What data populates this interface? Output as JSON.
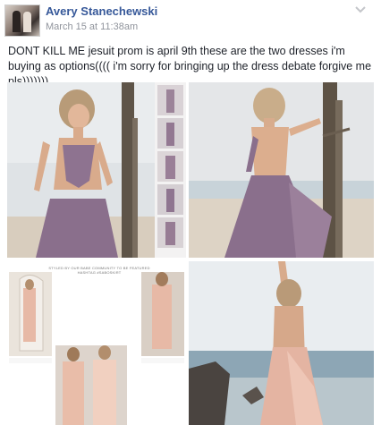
{
  "post": {
    "author": "Avery Stanechewski",
    "timestamp": "March 15 at 11:38am",
    "text": "DONT KILL ME jesuit prom is april 9th these are the two dresses i'm buying as options(((( i'm sorry for bringing up the dress debate forgive me pls)))))))"
  },
  "photos": [
    {
      "subject": "lavender halter cut-out maxi dress",
      "dress_color": "#8e7390"
    },
    {
      "subject": "lavender open-back maxi dress on beach",
      "dress_color": "#8a6f8c"
    },
    {
      "subject": "blush strapless dress collage",
      "dress_color": "#e7b9a6"
    },
    {
      "subject": "blush open-back dress by the sea",
      "dress_color": "#e4b4a2"
    }
  ],
  "collage": {
    "caption": "STYLED BY OUR BABE COMMUNITY TO BE FEATURED HASHTAG #SABOSKIRT",
    "handle": "@maria_gr"
  },
  "colors": {
    "link": "#365899",
    "meta": "#90949c",
    "text": "#1d2129"
  }
}
